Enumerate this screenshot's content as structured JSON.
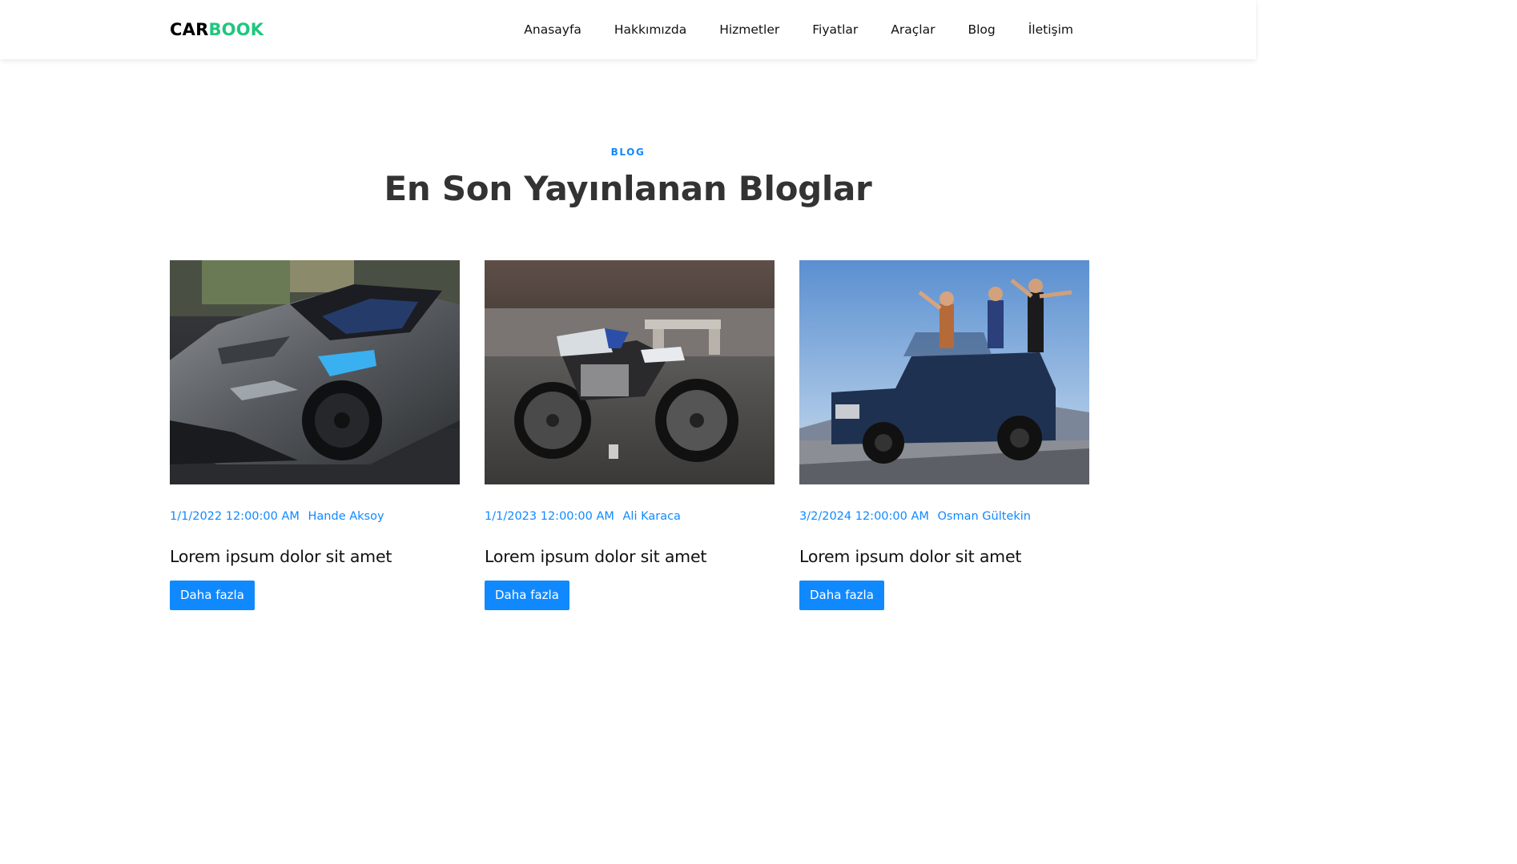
{
  "brand": {
    "logo_part1": "CAR",
    "logo_part2": "BOOK",
    "color_dark": "#000000",
    "color_accent": "#1fc77d"
  },
  "nav": {
    "items": [
      "Anasayfa",
      "Hakkımızda",
      "Hizmetler",
      "Fiyatlar",
      "Araçlar",
      "Blog",
      "İletişim"
    ]
  },
  "section": {
    "label": "BLOG",
    "title": "En Son Yayınlanan Bloglar"
  },
  "posts": [
    {
      "date": "1/1/2022 12:00:00 AM",
      "author": "Hande Aksoy",
      "title": "Lorem ipsum dolor sit amet",
      "button": "Daha fazla",
      "image": "sports-car-photo"
    },
    {
      "date": "1/1/2023 12:00:00 AM",
      "author": "Ali Karaca",
      "title": "Lorem ipsum dolor sit amet",
      "button": "Daha fazla",
      "image": "motorcycle-photo"
    },
    {
      "date": "3/2/2024 12:00:00 AM",
      "author": "Osman Gültekin",
      "title": "Lorem ipsum dolor sit amet",
      "button": "Daha fazla",
      "image": "jeep-photo"
    }
  ],
  "colors": {
    "primary": "#1089ff",
    "heading": "#333333",
    "accent_green": "#1fc77d"
  }
}
